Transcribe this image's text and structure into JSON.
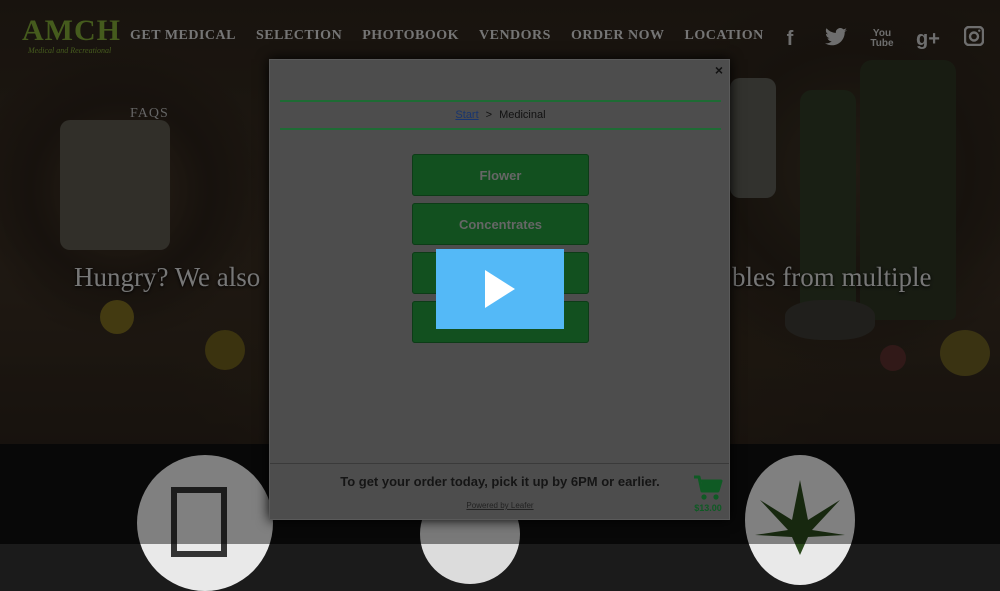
{
  "site": {
    "logo_text": "AMCH",
    "logo_subtitle": "Medical and Recreational",
    "nav": [
      "GET MEDICAL",
      "SELECTION",
      "PHOTOBOOK",
      "VENDORS",
      "ORDER NOW",
      "LOCATION"
    ],
    "faqs": "FAQS",
    "hero_left": "Hungry? We also",
    "hero_right": "bles from multiple",
    "socials": [
      {
        "icon": "facebook-icon",
        "glyph": "f"
      },
      {
        "icon": "twitter-icon",
        "glyph": "t"
      },
      {
        "icon": "youtube-icon",
        "glyph": "You Tube"
      },
      {
        "icon": "google-plus-icon",
        "glyph": "g+"
      },
      {
        "icon": "instagram-icon",
        "glyph": ""
      }
    ]
  },
  "modal": {
    "close": "×",
    "breadcrumb": {
      "start": "Start",
      "separator": ">",
      "current": "Medicinal"
    },
    "categories": [
      "Flower",
      "Concentrates",
      "",
      ""
    ],
    "footer_text": "To get your order today, pick it up by 6PM or earlier.",
    "powered_by": "Powered by Leafer",
    "cart_total": "$13.00"
  },
  "colors": {
    "accent_green": "#12501f",
    "play_blue": "#54b9f7",
    "logo_green": "#7fa636"
  }
}
